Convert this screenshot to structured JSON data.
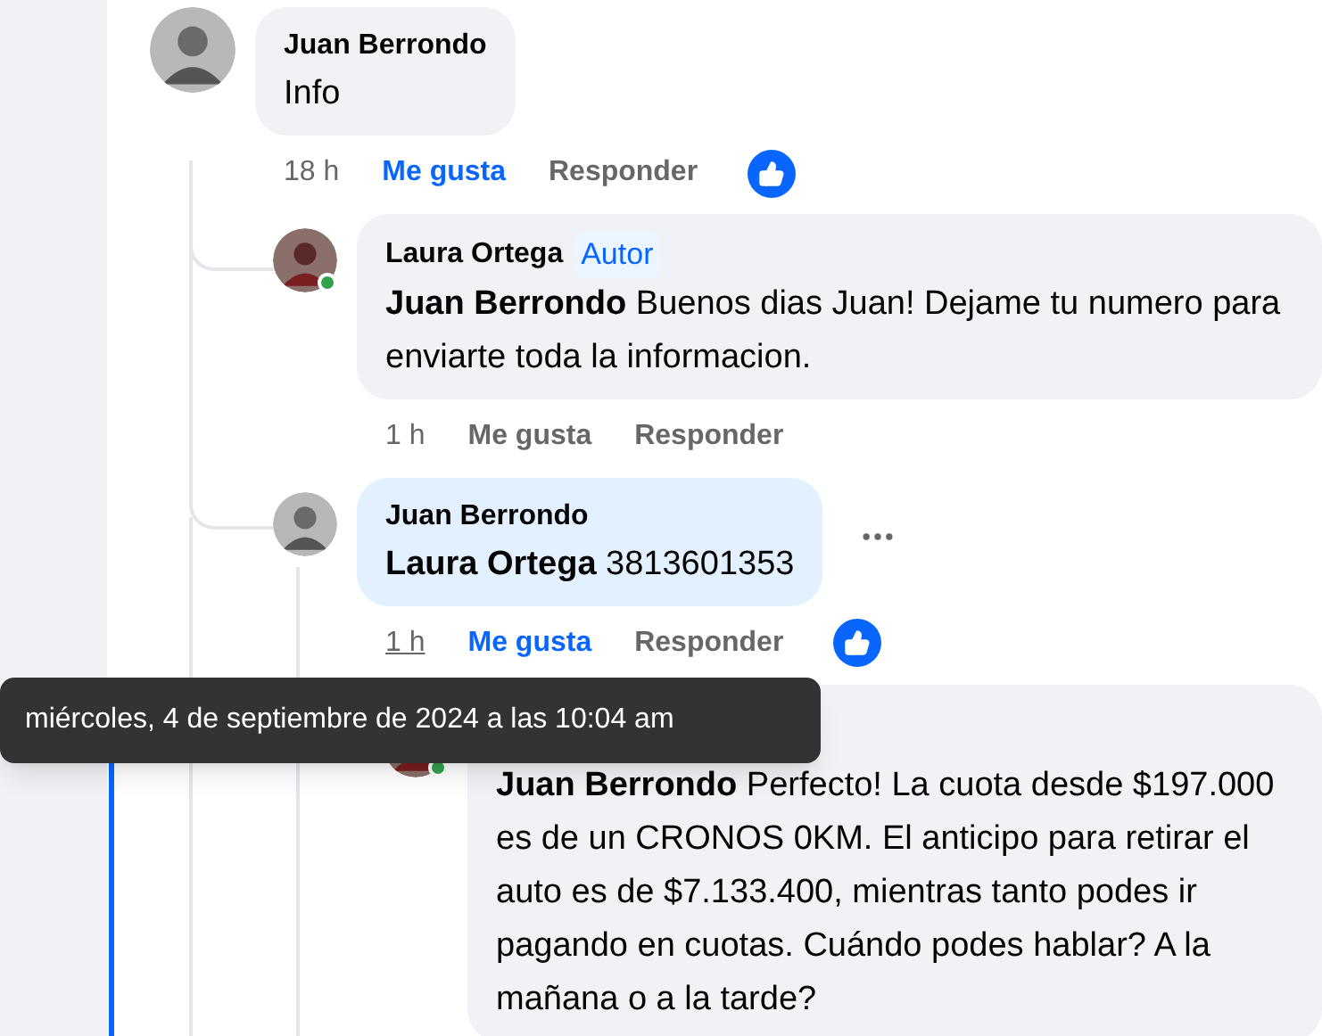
{
  "comments": [
    {
      "author": "Juan Berrondo",
      "text": "Info",
      "time": "18 h",
      "time_underlined": false,
      "like_label": "Me gusta",
      "liked": true,
      "reply_label": "Responder",
      "reaction_shown": true,
      "replies": [
        {
          "author": "Laura Ortega",
          "badge": "Autor",
          "online": true,
          "text": "**Juan Berrondo** Buenos dias Juan! Dejame tu numero para enviarte toda la informacion.",
          "time": "1 h",
          "time_underlined": false,
          "like_label": "Me gusta",
          "liked": false,
          "reply_label": "Responder"
        },
        {
          "author": "Juan Berrondo",
          "highlighted": true,
          "text": "**Laura Ortega** 3813601353",
          "time": "1 h",
          "time_underlined": true,
          "like_label": "Me gusta",
          "liked": true,
          "reply_label": "Responder",
          "reaction_shown": true,
          "more_menu": true,
          "replies": [
            {
              "online": true,
              "text": "**Juan Berrondo** Perfecto! La cuota desde $197.000 es de un CRONOS 0KM. El anticipo para retirar el auto es de $7.133.400, mientras tanto podes ir pagando en cuotas. Cuándo podes hablar? A la mañana o a la tarde?"
            }
          ]
        }
      ]
    }
  ],
  "tooltip": {
    "text": "miércoles, 4 de septiembre de 2024 a las 10:04 am"
  }
}
